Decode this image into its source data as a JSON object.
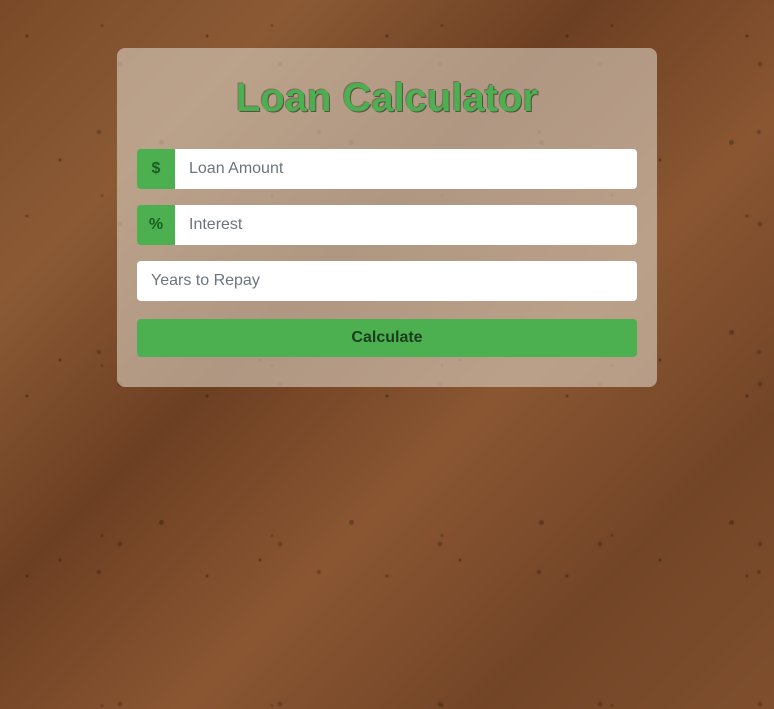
{
  "title": "Loan Calculator",
  "fields": {
    "loanAmount": {
      "prefix": "$",
      "placeholder": "Loan Amount",
      "value": ""
    },
    "interest": {
      "prefix": "%",
      "placeholder": "Interest",
      "value": ""
    },
    "years": {
      "placeholder": "Years to Repay",
      "value": ""
    }
  },
  "button": {
    "label": "Calculate"
  }
}
